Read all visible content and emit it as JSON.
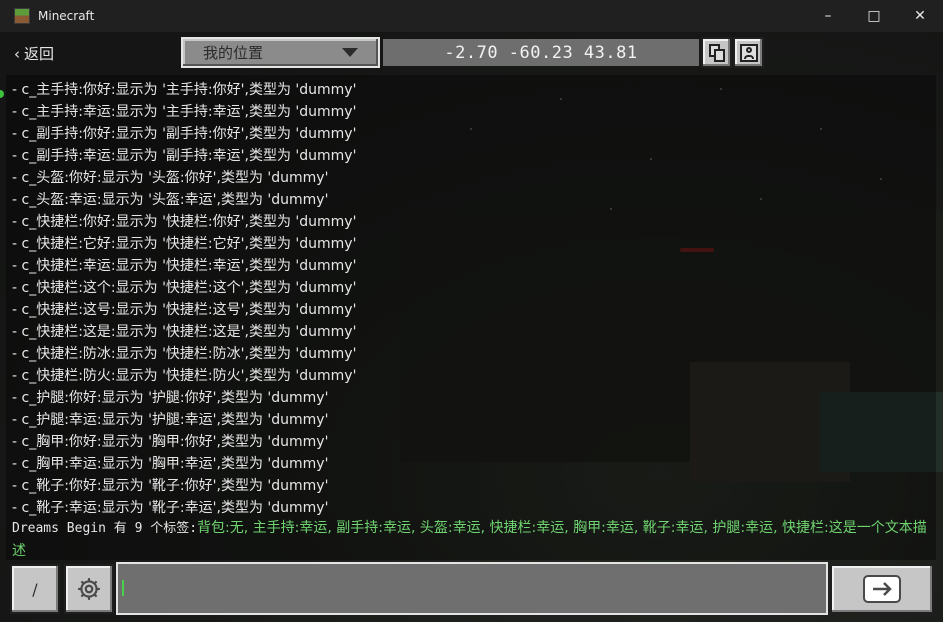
{
  "window": {
    "title": "Minecraft"
  },
  "topbar": {
    "back_label": "返回",
    "dropdown_label": "我的位置",
    "coordinates": "-2.70 -60.23 43.81"
  },
  "chat": {
    "lines": [
      "- c_主手持:你好:显示为 '主手持:你好',类型为 'dummy'",
      "- c_主手持:幸运:显示为 '主手持:幸运',类型为 'dummy'",
      "- c_副手持:你好:显示为 '副手持:你好',类型为 'dummy'",
      "- c_副手持:幸运:显示为 '副手持:幸运',类型为 'dummy'",
      "- c_头盔:你好:显示为 '头盔:你好',类型为 'dummy'",
      "- c_头盔:幸运:显示为 '头盔:幸运',类型为 'dummy'",
      "- c_快捷栏:你好:显示为 '快捷栏:你好',类型为 'dummy'",
      "- c_快捷栏:它好:显示为 '快捷栏:它好',类型为 'dummy'",
      "- c_快捷栏:幸运:显示为 '快捷栏:幸运',类型为 'dummy'",
      "- c_快捷栏:这个:显示为 '快捷栏:这个',类型为 'dummy'",
      "- c_快捷栏:这号:显示为 '快捷栏:这号',类型为 'dummy'",
      "- c_快捷栏:这是:显示为 '快捷栏:这是',类型为 'dummy'",
      "- c_快捷栏:防冰:显示为 '快捷栏:防冰',类型为 'dummy'",
      "- c_快捷栏:防火:显示为 '快捷栏:防火',类型为 'dummy'",
      "- c_护腿:你好:显示为 '护腿:你好',类型为 'dummy'",
      "- c_护腿:幸运:显示为 '护腿:幸运',类型为 'dummy'",
      "- c_胸甲:你好:显示为 '胸甲:你好',类型为 'dummy'",
      "- c_胸甲:幸运:显示为 '胸甲:幸运',类型为 'dummy'",
      "- c_靴子:你好:显示为 '靴子:你好',类型为 'dummy'",
      "- c_靴子:幸运:显示为 '靴子:幸运',类型为 'dummy'"
    ],
    "summary_prefix": "Dreams Begin 有 9 个标签:",
    "summary_tags": "背包:无, 主手持:幸运, 副手持:幸运, 头盔:幸运, 快捷栏:幸运, 胸甲:幸运, 靴子:幸运, 护腿:幸运, 快捷栏:这是一个文本描述"
  },
  "bottombar": {
    "slash_label": "/",
    "input_value": ""
  },
  "icons": {
    "back": "chevron-left-icon",
    "dropdown": "caret-down-icon",
    "copy": "copy-coordinates-icon",
    "profile": "profile-icon",
    "settings": "gear-icon",
    "send": "send-icon"
  }
}
